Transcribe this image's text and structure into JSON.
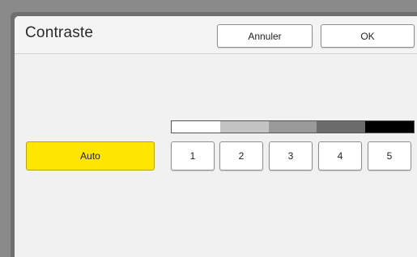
{
  "dialog": {
    "title": "Contraste",
    "cancel_label": "Annuler",
    "ok_label": "OK"
  },
  "contrast": {
    "auto_label": "Auto",
    "auto_color": "#ffe600",
    "levels": [
      "1",
      "2",
      "3",
      "4",
      "5"
    ],
    "scale_colors": [
      "#ffffff",
      "#c4c4c4",
      "#9a9a9a",
      "#6c6c6c",
      "#000000"
    ]
  }
}
